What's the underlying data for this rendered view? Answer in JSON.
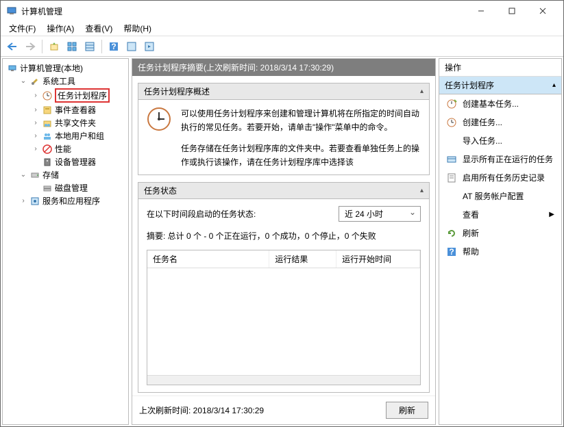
{
  "window": {
    "title": "计算机管理"
  },
  "menubar": {
    "file": "文件(F)",
    "action": "操作(A)",
    "view": "查看(V)",
    "help": "帮助(H)"
  },
  "tree": {
    "root": "计算机管理(本地)",
    "system_tools": "系统工具",
    "task_scheduler": "任务计划程序",
    "event_viewer": "事件查看器",
    "shared_folders": "共享文件夹",
    "local_users": "本地用户和组",
    "performance": "性能",
    "device_manager": "设备管理器",
    "storage": "存储",
    "disk_mgmt": "磁盘管理",
    "services_apps": "服务和应用程序"
  },
  "summary": {
    "header": "任务计划程序摘要(上次刷新时间: 2018/3/14 17:30:29)",
    "overview_title": "任务计划程序概述",
    "overview_body1": "可以使用任务计划程序来创建和管理计算机将在所指定的时间自动执行的常见任务。若要开始，请单击\"操作\"菜单中的命令。",
    "overview_body2": "任务存储在任务计划程序库的文件夹中。若要查看单独任务上的操作或执行该操作，请在任务计划程序库中选择该",
    "status_title": "任务状态",
    "status_period_label": "在以下时间段启动的任务状态:",
    "status_period_value": "近 24 小时",
    "status_summary": "摘要: 总计 0 个 - 0 个正在运行，0 个成功，0 个停止，0 个失败",
    "col_task": "任务名",
    "col_result": "运行结果",
    "col_start": "运行开始时间",
    "last_refresh": "上次刷新时间: 2018/3/14 17:30:29",
    "refresh_btn": "刷新"
  },
  "actions": {
    "pane_title": "操作",
    "heading": "任务计划程序",
    "create_basic": "创建基本任务...",
    "create_task": "创建任务...",
    "import": "导入任务...",
    "show_running": "显示所有正在运行的任务",
    "enable_history": "启用所有任务历史记录",
    "at_service": "AT 服务帐户配置",
    "view": "查看",
    "refresh": "刷新",
    "help": "帮助"
  }
}
